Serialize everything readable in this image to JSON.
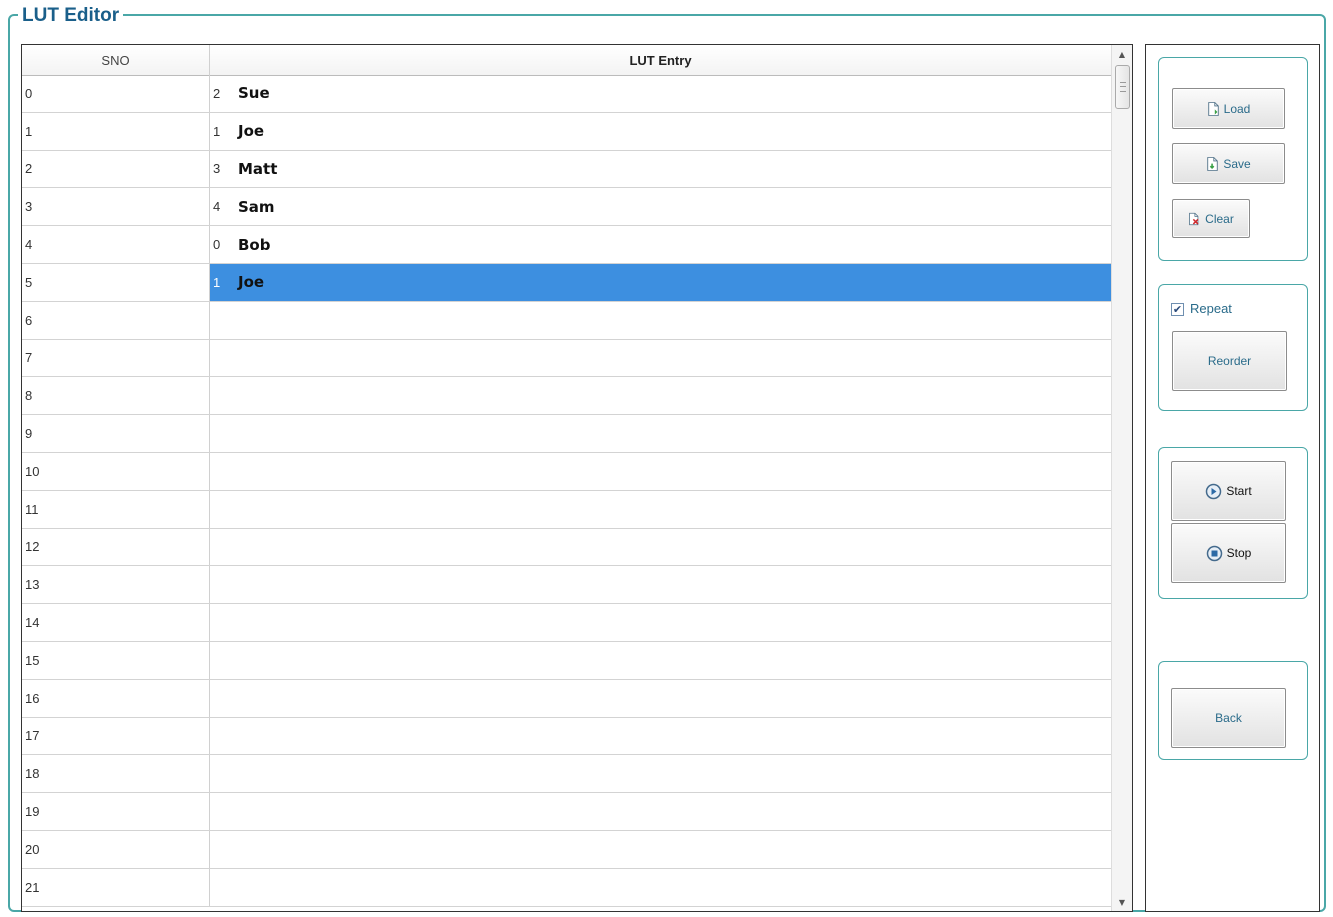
{
  "window": {
    "title": "LUT Editor"
  },
  "table": {
    "columns": [
      "SNO",
      "LUT Entry"
    ],
    "rows": [
      {
        "sno": "0",
        "num": "2",
        "name": "Sue"
      },
      {
        "sno": "1",
        "num": "1",
        "name": "Joe"
      },
      {
        "sno": "2",
        "num": "3",
        "name": "Matt"
      },
      {
        "sno": "3",
        "num": "4",
        "name": "Sam"
      },
      {
        "sno": "4",
        "num": "0",
        "name": "Bob"
      },
      {
        "sno": "5",
        "num": "1",
        "name": "Joe",
        "selected": true
      },
      {
        "sno": "6",
        "num": "",
        "name": ""
      },
      {
        "sno": "7",
        "num": "",
        "name": ""
      },
      {
        "sno": "8",
        "num": "",
        "name": ""
      },
      {
        "sno": "9",
        "num": "",
        "name": ""
      },
      {
        "sno": "10",
        "num": "",
        "name": ""
      },
      {
        "sno": "11",
        "num": "",
        "name": ""
      },
      {
        "sno": "12",
        "num": "",
        "name": ""
      },
      {
        "sno": "13",
        "num": "",
        "name": ""
      },
      {
        "sno": "14",
        "num": "",
        "name": ""
      },
      {
        "sno": "15",
        "num": "",
        "name": ""
      },
      {
        "sno": "16",
        "num": "",
        "name": ""
      },
      {
        "sno": "17",
        "num": "",
        "name": ""
      },
      {
        "sno": "18",
        "num": "",
        "name": ""
      },
      {
        "sno": "19",
        "num": "",
        "name": ""
      },
      {
        "sno": "20",
        "num": "",
        "name": ""
      },
      {
        "sno": "21",
        "num": "",
        "name": ""
      }
    ]
  },
  "file_group": {
    "load_label": "Load",
    "save_label": "Save",
    "clear_label": "Clear"
  },
  "order_group": {
    "repeat_label": "Repeat",
    "repeat_checked": true,
    "reorder_label": "Reorder"
  },
  "run_group": {
    "start_label": "Start",
    "stop_label": "Stop"
  },
  "nav_group": {
    "back_label": "Back"
  },
  "colors": {
    "frame_border": "#4aa7a7",
    "title_text": "#1a5f8a",
    "selection": "#3d8fe0"
  },
  "icons": {
    "load": "document-load-icon",
    "save": "document-save-icon",
    "clear": "document-clear-icon",
    "start": "play-circle-icon",
    "stop": "stop-circle-icon"
  }
}
